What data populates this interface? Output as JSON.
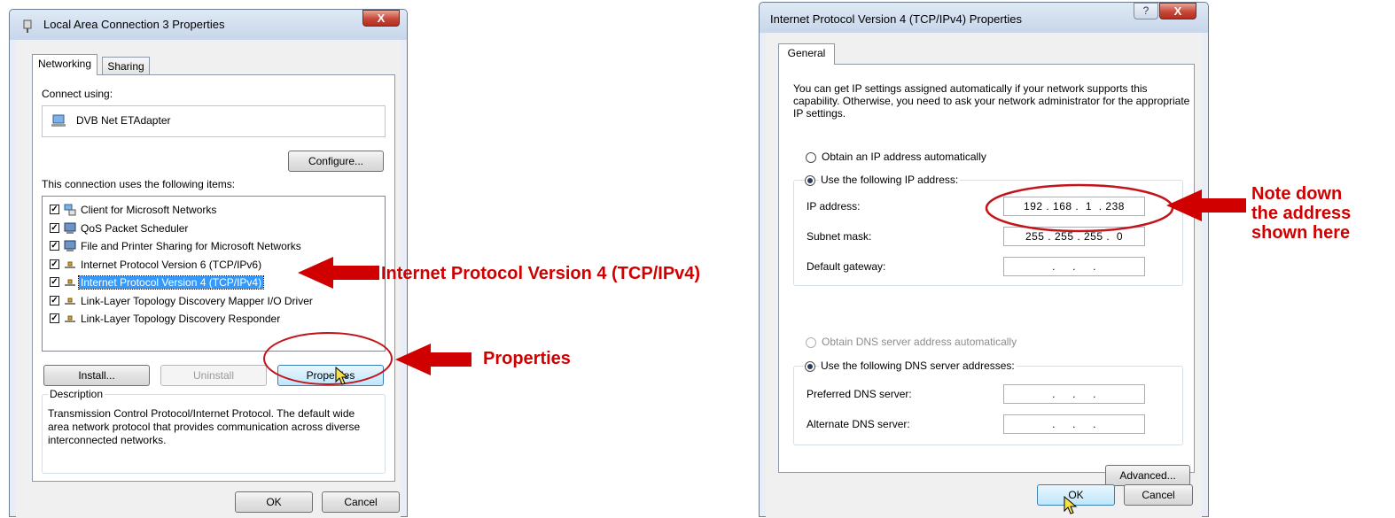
{
  "left_dialog": {
    "title": "Local Area Connection 3 Properties",
    "close_glyph": "X",
    "tabs": [
      "Networking",
      "Sharing"
    ],
    "connect_using_label": "Connect using:",
    "adapter_name": "DVB Net ETAdapter",
    "configure_label": "Configure...",
    "items_label": "This connection uses the following items:",
    "items": [
      {
        "label": "Client for Microsoft Networks",
        "checked": true,
        "icon": "network-client-icon"
      },
      {
        "label": "QoS Packet Scheduler",
        "checked": true,
        "icon": "service-icon"
      },
      {
        "label": "File and Printer Sharing for Microsoft Networks",
        "checked": true,
        "icon": "service-icon"
      },
      {
        "label": "Internet Protocol Version 6 (TCP/IPv6)",
        "checked": true,
        "icon": "protocol-icon"
      },
      {
        "label": "Internet Protocol Version 4 (TCP/IPv4)",
        "checked": true,
        "icon": "protocol-icon",
        "selected": true
      },
      {
        "label": "Link-Layer Topology Discovery Mapper I/O Driver",
        "checked": true,
        "icon": "protocol-icon"
      },
      {
        "label": "Link-Layer Topology Discovery Responder",
        "checked": true,
        "icon": "protocol-icon"
      }
    ],
    "install_label": "Install...",
    "uninstall_label": "Uninstall",
    "properties_label": "Properties",
    "description_label": "Description",
    "description_text": "Transmission Control Protocol/Internet Protocol. The default wide area network protocol that provides communication across diverse interconnected networks.",
    "ok_label": "OK",
    "cancel_label": "Cancel"
  },
  "right_dialog": {
    "title": "Internet Protocol Version 4 (TCP/IPv4) Properties",
    "help_glyph": "?",
    "close_glyph": "X",
    "tab": "General",
    "intro_text": "You can get IP settings assigned automatically if your network supports this capability. Otherwise, you need to ask your network administrator for the appropriate IP settings.",
    "obtain_ip_auto": "Obtain an IP address automatically",
    "use_following_ip": "Use the following IP address:",
    "ip_address_label": "IP address:",
    "ip_address_value": "192 . 168 .  1  . 238",
    "subnet_mask_label": "Subnet mask:",
    "subnet_mask_value": "255 . 255 . 255 .  0",
    "default_gateway_label": "Default gateway:",
    "default_gateway_value": ".     .     .",
    "obtain_dns_auto": "Obtain DNS server address automatically",
    "use_following_dns": "Use the following DNS server addresses:",
    "preferred_dns_label": "Preferred DNS server:",
    "preferred_dns_value": ".     .     .",
    "alternate_dns_label": "Alternate DNS server:",
    "alternate_dns_value": ".     .     .",
    "advanced_label": "Advanced...",
    "ok_label": "OK",
    "cancel_label": "Cancel"
  },
  "annotations": {
    "ipv4_note": "Internet Protocol Version 4 (TCP/IPv4)",
    "properties_note": "Properties",
    "note_line1": "Note down",
    "note_line2": "the address",
    "note_line3": "shown here"
  },
  "colors": {
    "annotation_red": "#d10000",
    "selection_blue": "#3399ff"
  }
}
